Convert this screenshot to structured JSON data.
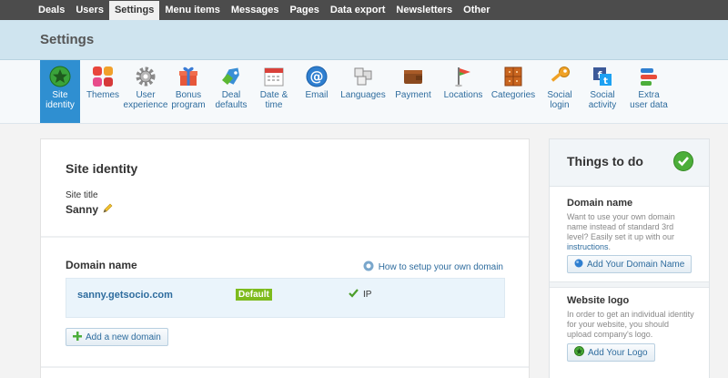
{
  "nav": {
    "items": [
      "Deals",
      "Users",
      "Settings",
      "Menu items",
      "Messages",
      "Pages",
      "Data export",
      "Newsletters",
      "Other"
    ],
    "active": "Settings"
  },
  "header": {
    "title": "Settings"
  },
  "toolbar": {
    "items": [
      {
        "label": "Site\nidentity",
        "icon": "star-badge-icon"
      },
      {
        "label": "Themes",
        "icon": "themes-icon"
      },
      {
        "label": "User\nexperience",
        "icon": "gear-icon"
      },
      {
        "label": "Bonus\nprogram",
        "icon": "gift-icon"
      },
      {
        "label": "Deal\ndefaults",
        "icon": "tag-icon"
      },
      {
        "label": "Date &\ntime",
        "icon": "calendar-icon"
      },
      {
        "label": "Email",
        "icon": "at-sign-icon"
      },
      {
        "label": "Languages",
        "icon": "keyboard-icon"
      },
      {
        "label": "Payment",
        "icon": "wallet-icon"
      },
      {
        "label": "Locations",
        "icon": "flag-icon"
      },
      {
        "label": "Categories",
        "icon": "cabinet-icon"
      },
      {
        "label": "Social\nlogin",
        "icon": "key-icon"
      },
      {
        "label": "Social\nactivity",
        "icon": "social-icon"
      },
      {
        "label": "Extra\nuser data",
        "icon": "bars-icon"
      }
    ]
  },
  "identity": {
    "section_title": "Site identity",
    "site_title_label": "Site title",
    "site_title_value": "Sanny"
  },
  "domain": {
    "title": "Domain name",
    "help_link": "How to setup your own domain",
    "rows": [
      {
        "url": "sanny.getsocio.com",
        "badge": "Default",
        "ip_label": "IP"
      }
    ],
    "add_button": "Add a new domain"
  },
  "todo": {
    "title": "Things to do",
    "items": [
      {
        "title": "Domain name",
        "desc": "Want to use your own domain name instead of standard 3rd level? Easily set it up with our",
        "link": "instructions",
        "button": "Add Your Domain Name"
      },
      {
        "title": "Website logo",
        "desc": "In order to get an individual identity for your website, you should upload company's logo.",
        "button": "Add Your Logo"
      }
    ]
  },
  "colors": {
    "accent": "#2f8fd1",
    "nav_bg": "#4c4c4c",
    "header_bg": "#cfe4ef",
    "badge_green": "#7dbb1d",
    "link": "#2e6c9e"
  }
}
